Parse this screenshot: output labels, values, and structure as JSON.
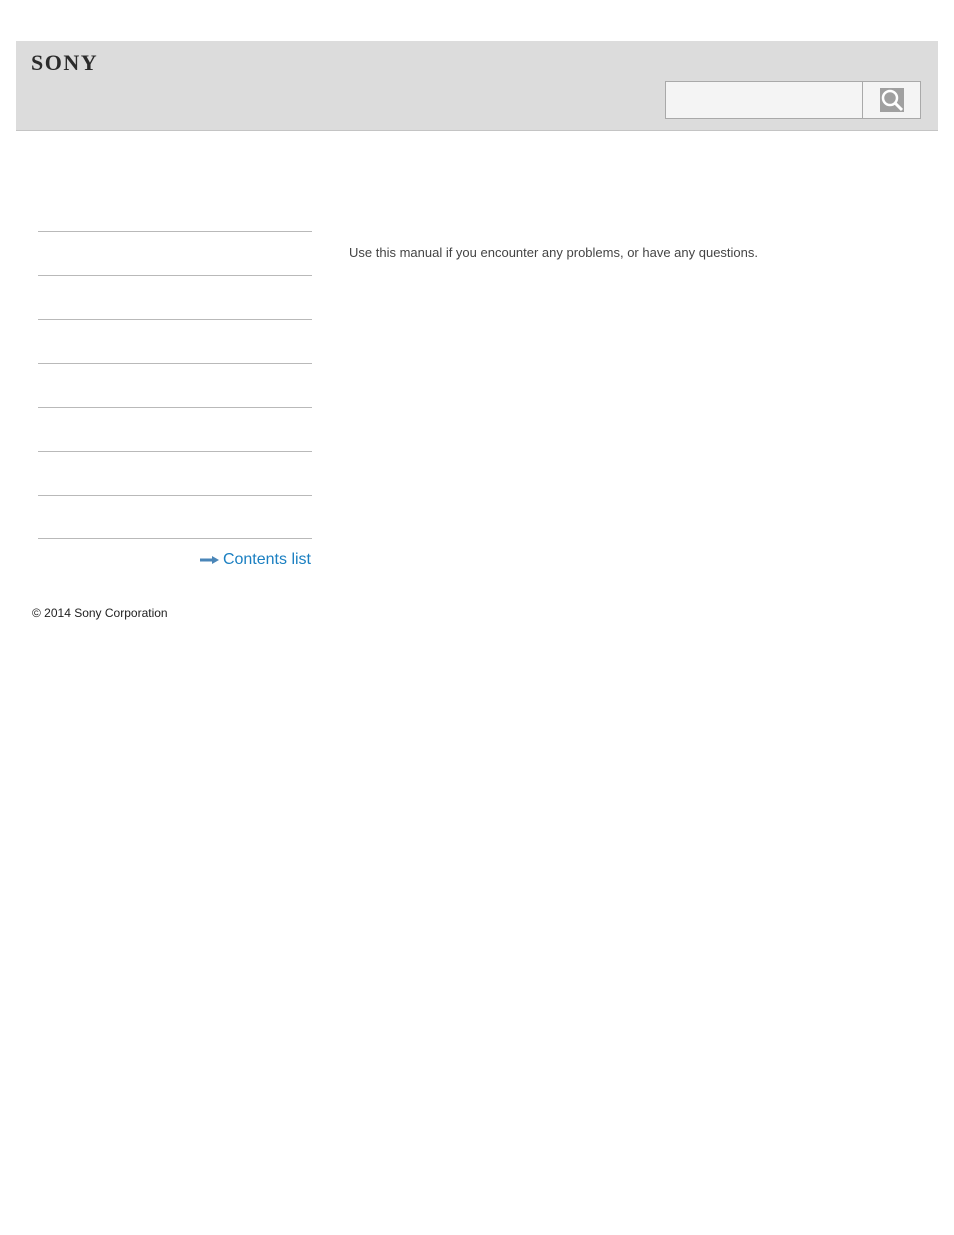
{
  "header": {
    "logo_text": "SONY",
    "search": {
      "placeholder": "",
      "value": "",
      "button_icon": "search-icon"
    }
  },
  "sidebar": {
    "items": [
      {
        "label": ""
      },
      {
        "label": ""
      },
      {
        "label": ""
      },
      {
        "label": ""
      },
      {
        "label": ""
      },
      {
        "label": ""
      },
      {
        "label": ""
      }
    ],
    "contents_link": {
      "icon": "arrow-right-icon",
      "label": "Contents list"
    }
  },
  "main": {
    "intro_text": "Use this manual if you encounter any problems, or have any questions."
  },
  "footer": {
    "copyright": "© 2014 Sony Corporation"
  },
  "colors": {
    "header_bg": "#dcdcdc",
    "link": "#1a7fc1",
    "divider": "#b9b9b9"
  }
}
